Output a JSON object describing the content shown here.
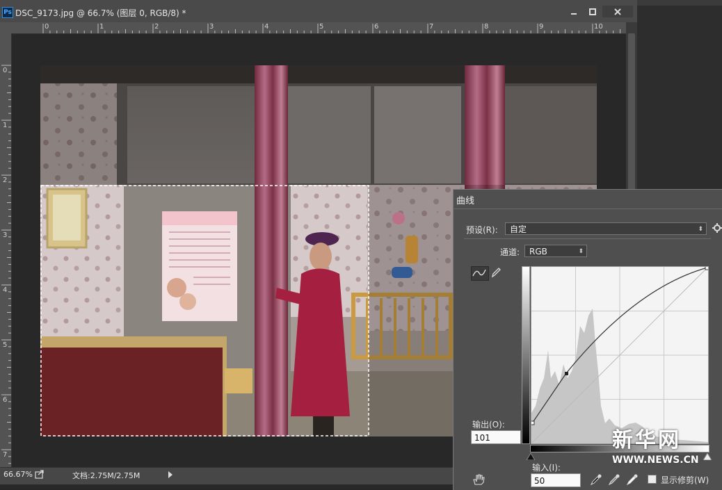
{
  "document": {
    "title": "DSC_9173.jpg @ 66.7% (图层 0, RGB/8) *",
    "app_icon": "Ps",
    "window_buttons": [
      "minimize-icon",
      "maximize-icon",
      "close-icon"
    ],
    "ruler_top_labels": [
      "0",
      "1",
      "2",
      "3",
      "4",
      "5",
      "6",
      "7",
      "8",
      "9",
      "10"
    ],
    "ruler_left_labels": [
      "0",
      "1",
      "2",
      "3",
      "4",
      "5",
      "6",
      "7"
    ],
    "status": {
      "zoom": "66.67%",
      "doc_size": "文档:2.75M/2.75M"
    }
  },
  "curves_dialog": {
    "title": "曲线",
    "preset_label": "预设(R):",
    "preset_value": "自定",
    "channel_label": "通道:",
    "channel_value": "RGB",
    "output_label": "输出(O):",
    "output_value": "101",
    "input_label": "输入(I):",
    "input_value": "50",
    "show_clipping_label": "显示修剪(W)",
    "show_clipping_checked": false,
    "curve_control_point": {
      "input": 50,
      "output": 101
    }
  },
  "watermark": {
    "main": "新华网",
    "sub": "WWW.NEWS.CN"
  },
  "colors": {
    "app_bg": "#282828",
    "panel_bg": "#4f4f4f",
    "ps_blue": "#2f8fe0"
  }
}
